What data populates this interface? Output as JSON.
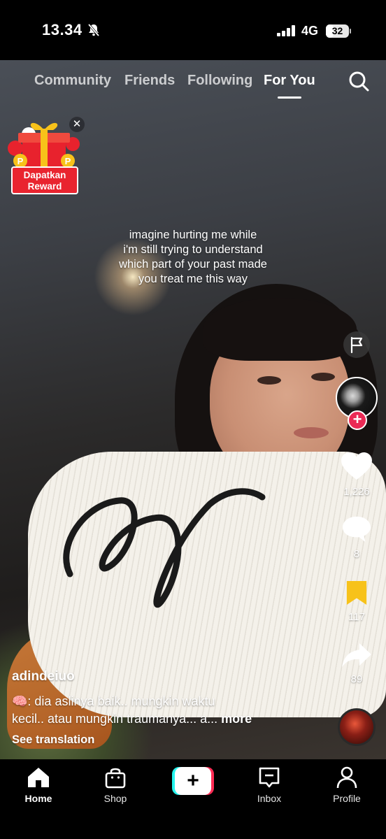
{
  "status_bar": {
    "time": "13.34",
    "network": "4G",
    "battery": "32",
    "battery_level": 0.32
  },
  "top_nav": {
    "tabs": [
      "Community",
      "Friends",
      "Following",
      "For You"
    ],
    "active_tab": "For You"
  },
  "reward": {
    "label_line1": "Dapatkan",
    "label_line2": "Reward"
  },
  "video": {
    "overlay_lines": [
      "imagine hurting me while",
      "i'm still trying to understand",
      "which part of your past made",
      "you treat me this way"
    ]
  },
  "actions": {
    "likes": "1,226",
    "comments": "8",
    "saves": "117",
    "shares": "89",
    "save_color": "#f7c21a",
    "follow_color": "#ea2a55"
  },
  "caption": {
    "username": "adindeiuo",
    "emoji": "🧠",
    "line1": ": dia aslinya baik.. mungkin waktu",
    "line2": "kecil.. atau mungkin traumanya... a...",
    "more": "more",
    "see_translation": "See translation"
  },
  "bottom_nav": {
    "items": [
      {
        "label": "Home",
        "icon": "home-icon"
      },
      {
        "label": "Shop",
        "icon": "shop-bag-icon"
      },
      {
        "label": "",
        "icon": "create-plus-icon"
      },
      {
        "label": "Inbox",
        "icon": "inbox-icon"
      },
      {
        "label": "Profile",
        "icon": "profile-icon"
      }
    ],
    "active": "Home"
  }
}
